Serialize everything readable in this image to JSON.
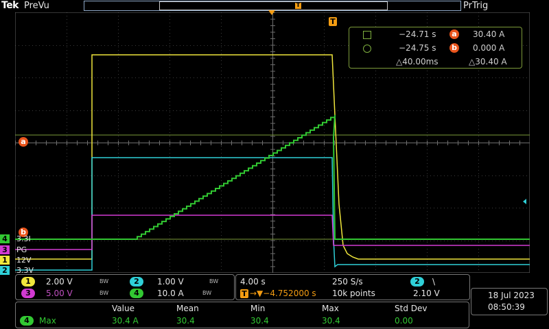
{
  "header": {
    "brand": "Tek",
    "acq_state": "PreVu",
    "trig_state": "PrTrig",
    "trig_marker": "T"
  },
  "cursor_readout": {
    "a_time": "−24.71 s",
    "a_value": "30.40 A",
    "b_time": "−24.75 s",
    "b_value": "0.000 A",
    "delta_time": "△40.00ms",
    "delta_value": "△30.40 A",
    "a_label": "a",
    "b_label": "b"
  },
  "channel_labels": {
    "ch4": {
      "num": "4",
      "name": "3.3I"
    },
    "ch3": {
      "num": "3",
      "name": "PG"
    },
    "ch1": {
      "num": "1",
      "name": "12V"
    },
    "ch2": {
      "num": "2",
      "name": "3.3V"
    }
  },
  "colors": {
    "ch1": "#f0e63c",
    "ch2": "#2fd0d8",
    "ch3": "#d23ad2",
    "ch4": "#32c832",
    "cursor": "#e8541c",
    "trigger": "#f39c12"
  },
  "vertical_panel": {
    "ch1": {
      "num": "1",
      "scale": "2.00 V",
      "bw": "BW"
    },
    "ch2": {
      "num": "2",
      "scale": "1.00 V",
      "bw": "BW"
    },
    "ch3": {
      "num": "3",
      "scale": "5.00 V",
      "bw": "BW"
    },
    "ch4": {
      "num": "4",
      "scale": "10.0 A",
      "bw": "BW"
    }
  },
  "horizontal_panel": {
    "time_div": "4.00 s",
    "sample_rate": "250 S/s",
    "trig_offset": "→▼−4.752000 s",
    "record_length": "10k points",
    "trig_source": "2",
    "trig_slope": "\\",
    "trig_level": "2.10 V"
  },
  "datetime": {
    "date": "18 Jul  2023",
    "time": "08:50:39"
  },
  "measurement": {
    "headers": [
      "Value",
      "Mean",
      "Min",
      "Max",
      "Std Dev"
    ],
    "source": "4",
    "name": "Max",
    "values": [
      "30.4 A",
      "30.4",
      "30.4",
      "30.4",
      "0.00"
    ]
  }
}
